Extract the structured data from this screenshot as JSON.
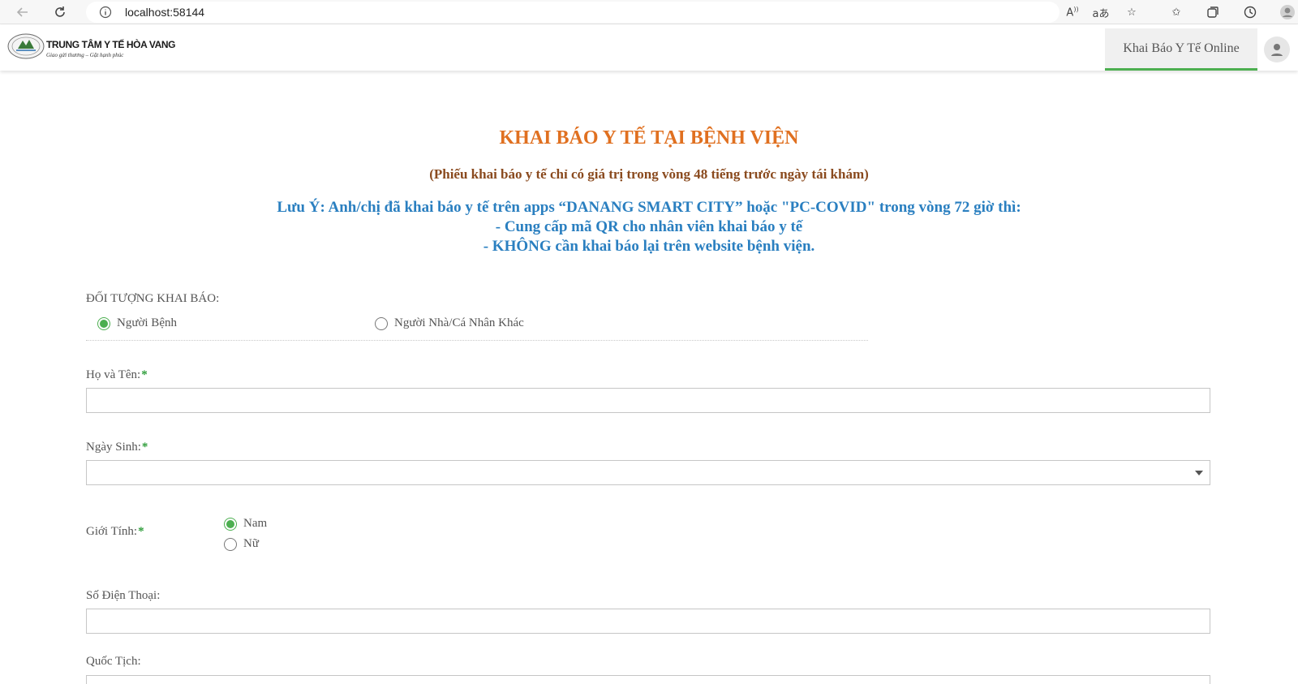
{
  "browser": {
    "url": "localhost:58144"
  },
  "header": {
    "org_name": "TRUNG TÂM Y TẾ HÒA VANG",
    "org_slogan": "Giao gửi thương – Gặt hạnh phúc",
    "tab_label": "Khai Báo Y Tế Online"
  },
  "page": {
    "title": "KHAI BÁO Y TẾ TẠI BỆNH VIỆN",
    "subtitle": "(Phiếu khai báo y tế chỉ có giá trị trong vòng 48 tiếng trước ngày tái khám)",
    "note_line1": "Lưu Ý: Anh/chị đã khai báo y tế trên apps “DANANG SMART CITY” hoặc \"PC-COVID\" trong vòng 72 giờ thì:",
    "note_line2": "- Cung cấp mã QR cho nhân viên khai báo y tế",
    "note_line3": "- KHÔNG cần khai báo lại trên website bệnh viện."
  },
  "form": {
    "subject_label": "ĐỐI TƯỢNG KHAI BÁO:",
    "subject_options": [
      {
        "label": "Người Bệnh",
        "checked": true
      },
      {
        "label": "Người Nhà/Cá Nhân Khác",
        "checked": false
      }
    ],
    "fullname_label": "Họ và Tên:",
    "fullname_value": "",
    "dob_label": "Ngày Sinh:",
    "dob_value": "",
    "gender_label": "Giới Tính:",
    "gender_options": [
      {
        "label": "Nam",
        "checked": true
      },
      {
        "label": "Nữ",
        "checked": false
      }
    ],
    "phone_label": "Số Điện Thoại:",
    "phone_value": "",
    "nationality_label": "Quốc Tịch:",
    "required_mark": "*"
  },
  "colors": {
    "title": "#e07020",
    "subtitle": "#8a4a1e",
    "note": "#2a7fc0",
    "accent": "#4caf50"
  }
}
